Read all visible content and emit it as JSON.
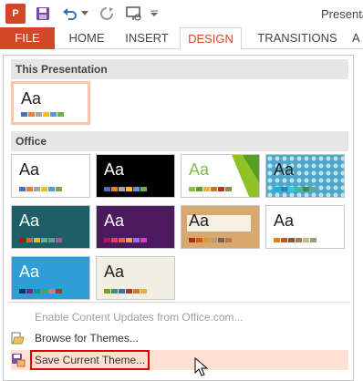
{
  "app": {
    "title": "Presentat",
    "logo_letter": "P"
  },
  "tabs": [
    {
      "label": "FILE"
    },
    {
      "label": "HOME"
    },
    {
      "label": "INSERT"
    },
    {
      "label": "DESIGN"
    },
    {
      "label": "TRANSITIONS"
    },
    {
      "label": "A"
    }
  ],
  "gallery": {
    "section_this": "This Presentation",
    "section_office": "Office",
    "aa_label": "Aa",
    "themes": [
      {
        "name": "current",
        "bg": "#ffffff",
        "fg": "#222222",
        "bars": [
          "#4472c4",
          "#ed7d31",
          "#a5a5a5",
          "#ffc000",
          "#5b9bd5",
          "#70ad47"
        ]
      },
      {
        "name": "office-theme",
        "bg": "#ffffff",
        "fg": "#222222",
        "bars": [
          "#4472c4",
          "#ed7d31",
          "#a5a5a5",
          "#ffc000",
          "#5b9bd5",
          "#70ad47"
        ]
      },
      {
        "name": "office-black",
        "bg": "#000000",
        "fg": "#ffffff",
        "bars": [
          "#4472c4",
          "#ed7d31",
          "#a5a5a5",
          "#ffc000",
          "#5b9bd5",
          "#70ad47"
        ]
      },
      {
        "name": "facet",
        "bg": "#ffffff",
        "fg": "#7fbd4d",
        "bars": [
          "#90c226",
          "#54a021",
          "#e6b91e",
          "#e76618",
          "#c42f1a",
          "#918655"
        ]
      },
      {
        "name": "pattern-blue",
        "bg": "#4fa8c9",
        "fg": "#222222",
        "bars": [
          "#1cade4",
          "#2683c6",
          "#27ced7",
          "#42ba97",
          "#3e8853",
          "#62a39f"
        ]
      },
      {
        "name": "ion-teal",
        "bg": "#1e5f67",
        "fg": "#ffffff",
        "bars": [
          "#b01513",
          "#ea6312",
          "#e6b729",
          "#6aac90",
          "#5f9c9d",
          "#9e5e9b"
        ]
      },
      {
        "name": "ion-purple",
        "bg": "#4b1a5e",
        "fg": "#ffffff",
        "bars": [
          "#b31166",
          "#e33d6f",
          "#e45f3c",
          "#e9a339",
          "#9b6bf2",
          "#d53dd0"
        ]
      },
      {
        "name": "wood",
        "bg": "#d9a86e",
        "fg": "#222222",
        "bars": [
          "#a5300f",
          "#d55816",
          "#e19825",
          "#b19c7d",
          "#7f5f52",
          "#b27d49"
        ]
      },
      {
        "name": "retrospect",
        "bg": "#ffffff",
        "fg": "#222222",
        "bars": [
          "#e48312",
          "#bd582c",
          "#865640",
          "#9b8357",
          "#c2bc80",
          "#94a088"
        ]
      },
      {
        "name": "slice-blue",
        "bg": "#2e9fd6",
        "fg": "#ffffff",
        "bars": [
          "#052f61",
          "#a50e82",
          "#14967c",
          "#6a9e1f",
          "#e87d37",
          "#c62324"
        ]
      },
      {
        "name": "organic",
        "bg": "#f1efe4",
        "fg": "#222222",
        "bars": [
          "#83992a",
          "#3c9770",
          "#44709d",
          "#a23c33",
          "#d97828",
          "#deb340"
        ]
      }
    ]
  },
  "menu": {
    "enable_updates": "Enable Content Updates from Office.com...",
    "browse_themes": "Browse for Themes...",
    "save_theme": "Save Current Theme..."
  }
}
